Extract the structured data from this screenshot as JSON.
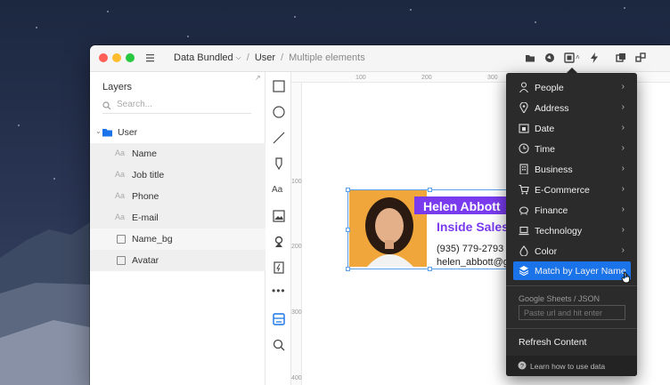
{
  "window": {
    "breadcrumb": {
      "doc": "Data Bundled",
      "page": "User",
      "selection": "Multiple elements"
    }
  },
  "layers": {
    "title": "Layers",
    "search_placeholder": "Search...",
    "group": "User",
    "items": [
      {
        "type": "text",
        "prefix": "Aa",
        "label": "Name"
      },
      {
        "type": "text",
        "prefix": "Aa",
        "label": "Job title"
      },
      {
        "type": "text",
        "prefix": "Aa",
        "label": "Phone"
      },
      {
        "type": "text",
        "prefix": "Aa",
        "label": "E-mail"
      },
      {
        "type": "shape",
        "label": "Name_bg"
      },
      {
        "type": "shape",
        "label": "Avatar"
      }
    ]
  },
  "tools": {
    "text_tool_label": "Aa",
    "icons": [
      "rectangle-icon",
      "oval-icon",
      "line-icon",
      "pen-icon",
      "text-icon",
      "image-icon",
      "stamp-icon",
      "symbol-icon",
      "more-icon",
      "data-icon",
      "zoom-icon"
    ]
  },
  "rulers": {
    "top": [
      "100",
      "200",
      "300"
    ],
    "left": [
      "100",
      "200",
      "300",
      "400"
    ]
  },
  "card": {
    "name": "Helen Abbott",
    "job": "Inside Sales",
    "phone": "(935) 779-2793",
    "email": "helen_abbott@g"
  },
  "menu": {
    "items": [
      {
        "label": "People",
        "icon": "person-icon"
      },
      {
        "label": "Address",
        "icon": "pin-icon"
      },
      {
        "label": "Date",
        "icon": "calendar-icon"
      },
      {
        "label": "Time",
        "icon": "clock-icon"
      },
      {
        "label": "Business",
        "icon": "building-icon"
      },
      {
        "label": "E-Commerce",
        "icon": "cart-icon"
      },
      {
        "label": "Finance",
        "icon": "piggy-bank-icon"
      },
      {
        "label": "Technology",
        "icon": "laptop-icon"
      },
      {
        "label": "Color",
        "icon": "drop-icon"
      }
    ],
    "match_label": "Match by Layer Name",
    "google_sheets_label": "Google Sheets / JSON",
    "url_placeholder": "Paste url and hit enter",
    "refresh_label": "Refresh Content",
    "learn_label": "Learn how to use data"
  },
  "colors": {
    "accent": "#1a73e8",
    "brand_purple": "#7a3bef",
    "avatar_bg": "#f0a63a",
    "menu_bg": "#2b2b2b"
  }
}
